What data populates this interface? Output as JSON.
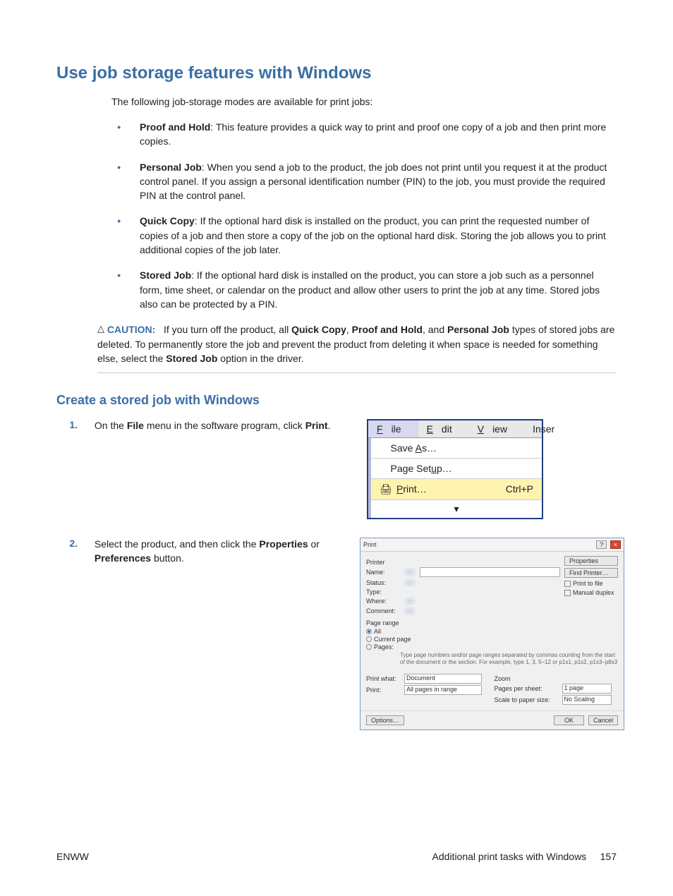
{
  "h1": "Use job storage features with Windows",
  "intro": "The following job-storage modes are available for print jobs:",
  "bullets": [
    {
      "bold": "Proof and Hold",
      "rest": ": This feature provides a quick way to print and proof one copy of a job and then print more copies."
    },
    {
      "bold": "Personal Job",
      "rest": ": When you send a job to the product, the job does not print until you request it at the product control panel. If you assign a personal identification number (PIN) to the job, you must provide the required PIN at the control panel."
    },
    {
      "bold": "Quick Copy",
      "rest": ": If the optional hard disk is installed on the product, you can print the requested number of copies of a job and then store a copy of the job on the optional hard disk. Storing the job allows you to print additional copies of the job later."
    },
    {
      "bold": "Stored Job",
      "rest": ": If the optional hard disk is installed on the product, you can store a job such as a personnel form, time sheet, or calendar on the product and allow other users to print the job at any time. Stored jobs also can be protected by a PIN."
    }
  ],
  "caution": {
    "label": "CAUTION:",
    "pre": "If you turn off the product, all ",
    "b1": "Quick Copy",
    "sep1": ", ",
    "b2": "Proof and Hold",
    "sep2": ", and ",
    "b3": "Personal Job",
    "post": " types of stored jobs are deleted. To permanently store the job and prevent the product from deleting it when space is needed for something else, select the ",
    "b4": "Stored Job",
    "tail": " option in the driver."
  },
  "h2": "Create a stored job with Windows",
  "steps": [
    {
      "num": "1.",
      "pre": "On the ",
      "b1": "File",
      "mid": " menu in the software program, click ",
      "b2": "Print",
      "tail": "."
    },
    {
      "num": "2.",
      "pre": "Select the product, and then click the ",
      "b1": "Properties",
      "mid": " or ",
      "b2": "Preferences",
      "tail": " button."
    }
  ],
  "menu": {
    "bar": {
      "file": "File",
      "edit": "Edit",
      "view": "View",
      "inser": "Inser"
    },
    "items": {
      "saveas": "Save As…",
      "pagesetup": "Page Setup…",
      "print": "Print…",
      "shortcut": "Ctrl+P"
    }
  },
  "dlg": {
    "title": "Print",
    "help": "?",
    "close": "×",
    "printer": "Printer",
    "name": "Name:",
    "status": "Status:",
    "type": "Type:",
    "where": "Where:",
    "comment": "Comment:",
    "properties": "Properties",
    "findprinter": "Find Printer…",
    "printtofile": "Print to file",
    "manualduplex": "Manual duplex",
    "pagerange": "Page range",
    "all": "All",
    "current": "Current page",
    "pages": "Pages:",
    "note1": "Type page numbers and/or page ranges separated by commas counting from the start of the document or the section. For example, type 1, 3, 5–12 or p1s1, p1s2, p1s3–p8s3",
    "printwhat": "Print what:",
    "printwhat_val": "Document",
    "print": "Print:",
    "print_val": "All pages in range",
    "zoom": "Zoom",
    "pps": "Pages per sheet:",
    "pps_val": "1 page",
    "scale": "Scale to paper size:",
    "scale_val": "No Scaling",
    "options": "Options…",
    "ok": "OK",
    "cancel": "Cancel"
  },
  "footer": {
    "left": "ENWW",
    "right_label": "Additional print tasks with Windows",
    "page": "157"
  }
}
